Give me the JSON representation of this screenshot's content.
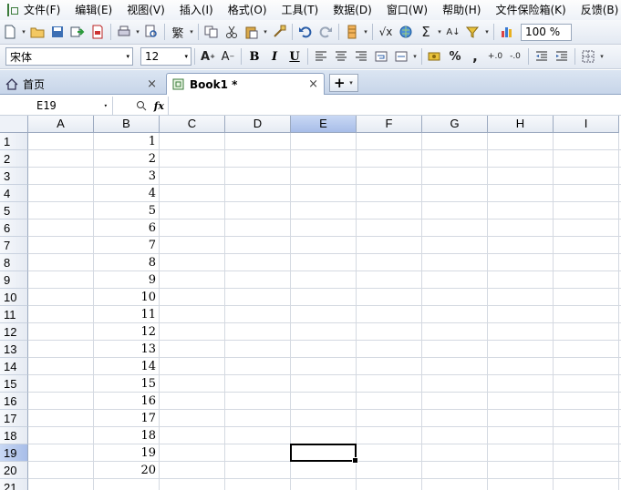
{
  "menu": [
    "文件(F)",
    "编辑(E)",
    "视图(V)",
    "插入(I)",
    "格式(O)",
    "工具(T)",
    "数据(D)",
    "窗口(W)",
    "帮助(H)",
    "文件保险箱(K)",
    "反馈(B)"
  ],
  "toolbar": {
    "zoom": "100 %",
    "traditional_label": "繁",
    "sum_symbol": "Σ"
  },
  "format": {
    "font_name": "宋体",
    "font_size": "12",
    "bold": "B",
    "italic": "I",
    "underline": "U",
    "percent": "%",
    "comma": ","
  },
  "tabs": {
    "home_label": "首页",
    "book_label": "Book1 *",
    "new_tab": "+"
  },
  "formula_bar": {
    "name_box": "E19",
    "fx": "fx",
    "formula": ""
  },
  "sheet": {
    "columns": [
      "A",
      "B",
      "C",
      "D",
      "E",
      "F",
      "G",
      "H",
      "I"
    ],
    "rows": [
      "1",
      "2",
      "3",
      "4",
      "5",
      "6",
      "7",
      "8",
      "9",
      "10",
      "11",
      "12",
      "13",
      "14",
      "15",
      "16",
      "17",
      "18",
      "19",
      "20",
      "21"
    ],
    "column_b_values": [
      "1",
      "2",
      "3",
      "4",
      "5",
      "6",
      "7",
      "8",
      "9",
      "10",
      "11",
      "12",
      "13",
      "14",
      "15",
      "16",
      "17",
      "18",
      "19",
      "20"
    ],
    "selected_column": "E",
    "selected_row": "19"
  },
  "colors": {
    "selection_header": "#a7bde8",
    "gridline": "#d4d9e1"
  }
}
